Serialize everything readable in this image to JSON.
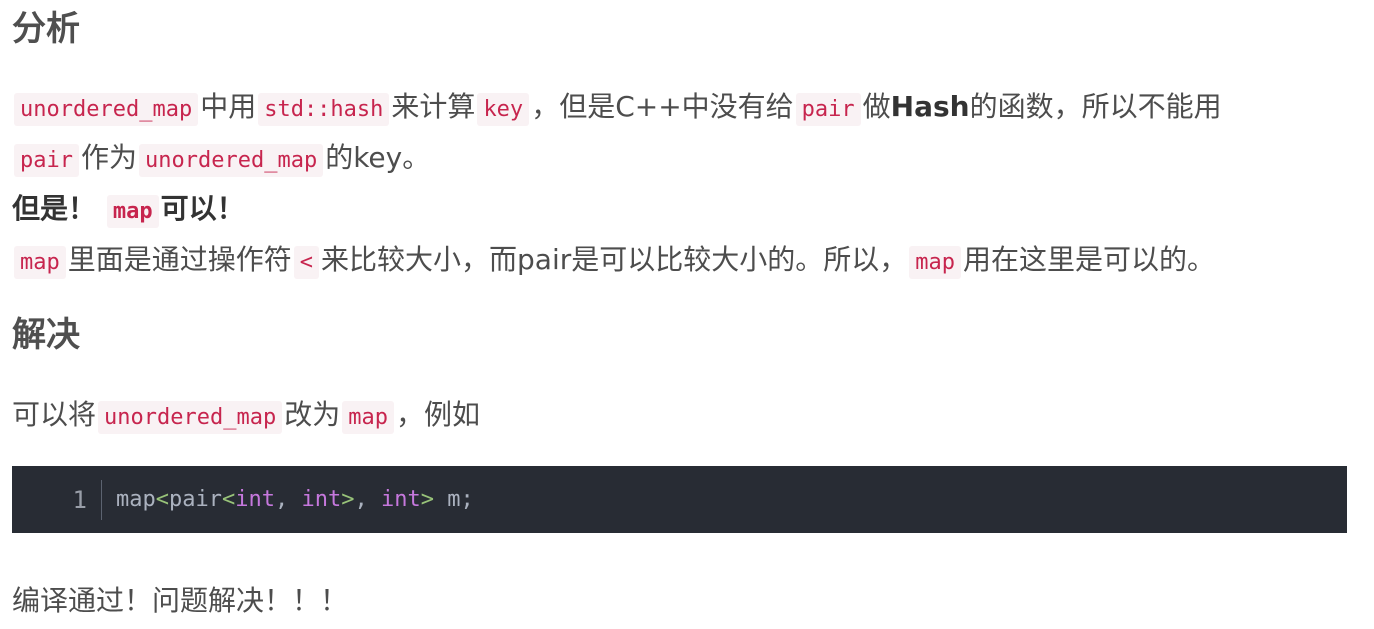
{
  "headings": {
    "analysis": "分析",
    "solution": "解决"
  },
  "para1": {
    "code_unordered_map": "unordered_map",
    "t1": "中用",
    "code_std_hash": "std::hash",
    "t2": "来计算",
    "code_key": "key",
    "t3": "，但是C++中没有给",
    "code_pair": "pair",
    "t4": "做",
    "bold_hash": "Hash",
    "t5": "的函数，所以不能用",
    "code_pair2": "pair",
    "t6": "作为",
    "code_unordered_map2": "unordered_map",
    "t7": "的key。"
  },
  "para2": {
    "bold_but": "但是！",
    "code_map": "map",
    "bold_can": "可以！"
  },
  "para3": {
    "code_map": "map",
    "t1": "里面是通过操作符",
    "code_lt": "<",
    "t2": "来比较大小，而pair是可以比较大小的。所以，",
    "code_map2": "map",
    "t3": "用在这里是可以的。"
  },
  "solution": {
    "t1": "可以将",
    "code_unordered_map": "unordered_map",
    "t2": "改为",
    "code_map": "map",
    "t3": "，例如"
  },
  "code_block": {
    "line_number": "1",
    "tokens": {
      "a": "map",
      "b": "<",
      "c": "pair",
      "d": "<",
      "e": "int",
      "f": ", ",
      "g": "int",
      "h": ">",
      "i": ", ",
      "j": "int",
      "k": ">",
      "l": " m;"
    }
  },
  "final_line": "编译通过！问题解决！！！"
}
